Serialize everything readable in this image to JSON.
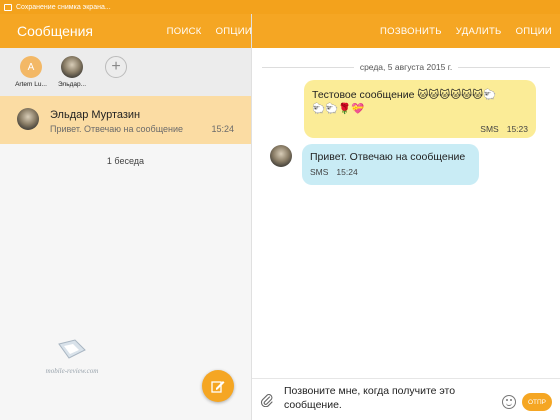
{
  "status_bar": {
    "text": "Сохранение снимка экрана..."
  },
  "left_appbar": {
    "title": "Сообщения",
    "actions": [
      "ПОИСК",
      "ОПЦИИ"
    ]
  },
  "right_appbar": {
    "actions": [
      "ПОЗВОНИТЬ",
      "УДАЛИТЬ",
      "ОПЦИИ"
    ]
  },
  "contacts": [
    {
      "initial": "A",
      "name": "Artem Lu..."
    },
    {
      "initial": "",
      "name": "Эльдар..."
    },
    {
      "initial": "+",
      "name": ""
    }
  ],
  "thread": {
    "name": "Эльдар Муртазин",
    "preview": "Привет. Отвечаю на сообщение",
    "time": "15:24"
  },
  "thread_count": "1 беседа",
  "watermark": {
    "text": "mobile-review.com"
  },
  "conversation": {
    "date": "среда, 5 августа 2015 г.",
    "messages": [
      {
        "direction": "out",
        "text": "Тестовое сообщение",
        "emoji_line1": "🐱🐱🐱🐱🐱🐱🐑",
        "emoji_line2": "🐑🐑🌹💝",
        "type": "SMS",
        "time": "15:23"
      },
      {
        "direction": "in",
        "text": "Привет. Отвечаю на сообщение",
        "type": "SMS",
        "time": "15:24"
      }
    ]
  },
  "composer": {
    "text_line1": "Позвоните мне, когда получите это",
    "text_line2": "сообщение.",
    "send_label": "ОТПР"
  },
  "colors": {
    "accent": "#f5a623",
    "outgoing_bubble": "#fbec97",
    "incoming_bubble": "#c9ecf5",
    "selected_row": "#fbdca3"
  }
}
